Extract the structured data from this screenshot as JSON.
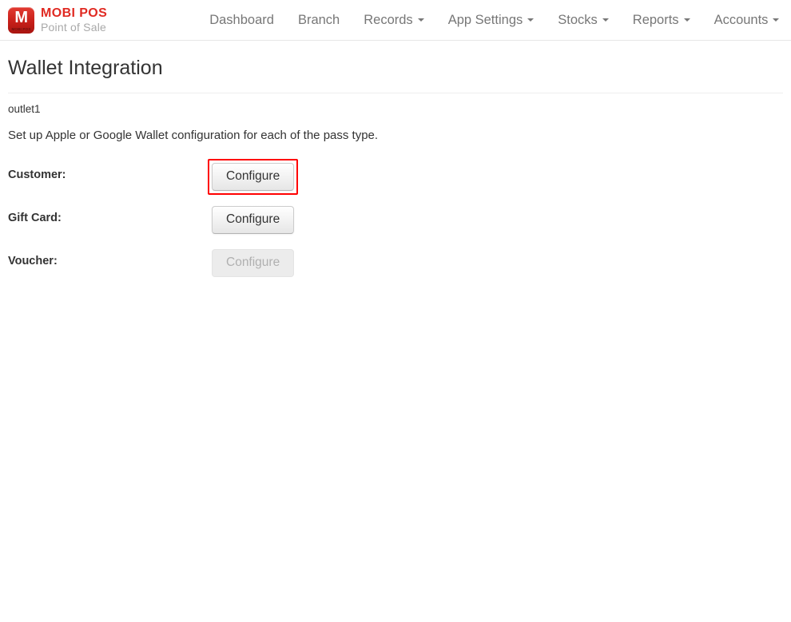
{
  "brand": {
    "logo_glyph": "M",
    "logo_sub": "MOBI POS",
    "title": "MOBI POS",
    "subtitle": "Point of Sale",
    "icon_name": "mobipos-logo-icon"
  },
  "nav": {
    "items": [
      {
        "label": "Dashboard",
        "has_caret": false
      },
      {
        "label": "Branch",
        "has_caret": false
      },
      {
        "label": "Records",
        "has_caret": true
      },
      {
        "label": "App Settings",
        "has_caret": true
      },
      {
        "label": "Stocks",
        "has_caret": true
      },
      {
        "label": "Reports",
        "has_caret": true
      },
      {
        "label": "Accounts",
        "has_caret": true
      }
    ],
    "account": {
      "label": "",
      "redacted": true,
      "has_caret": true
    }
  },
  "page": {
    "title": "Wallet Integration",
    "outlet": "outlet1",
    "description": "Set up Apple or Google Wallet configuration for each of the pass type."
  },
  "form": {
    "rows": [
      {
        "label": "Customer:",
        "button_label": "Configure",
        "disabled": false,
        "highlighted": true
      },
      {
        "label": "Gift Card:",
        "button_label": "Configure",
        "disabled": false,
        "highlighted": false
      },
      {
        "label": "Voucher:",
        "button_label": "Configure",
        "disabled": true,
        "highlighted": false
      }
    ]
  },
  "colors": {
    "brand_red": "#e02a22",
    "highlight_red": "#ff0000",
    "nav_text": "#777777",
    "body_text": "#333333"
  }
}
